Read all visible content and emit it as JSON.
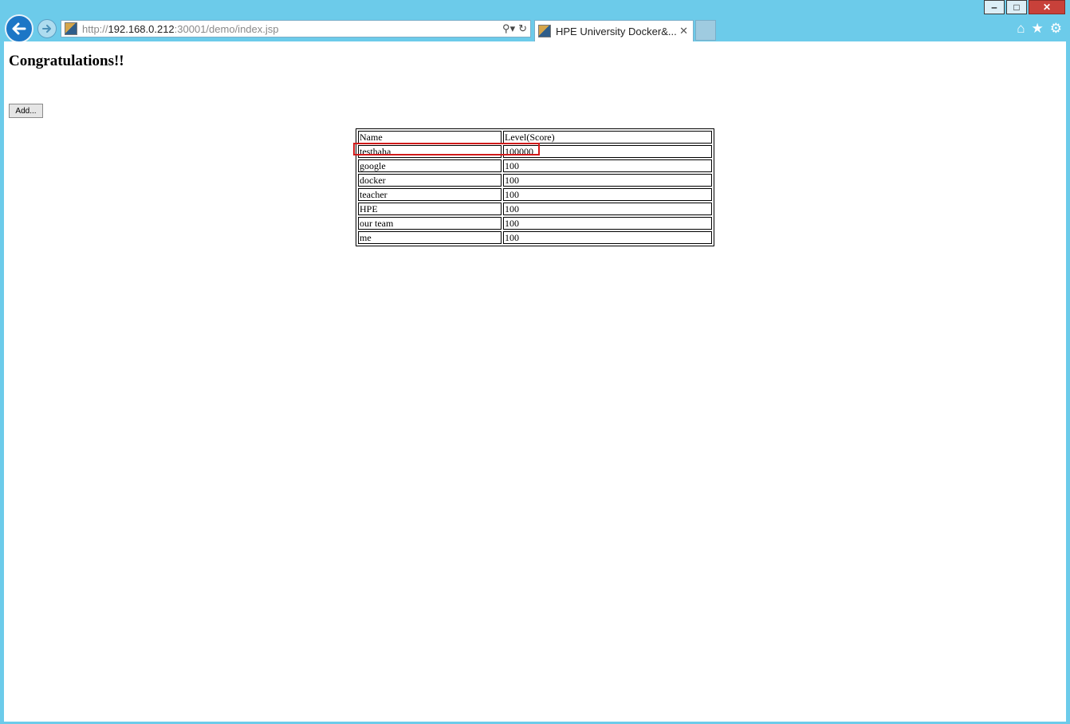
{
  "browser": {
    "url_prefix": "http://",
    "url_host": "192.168.0.212",
    "url_rest": ":30001/demo/index.jsp",
    "tab_title": "HPE University Docker&...",
    "window_buttons": {
      "minimize": "‒",
      "maximize": "□",
      "close": "✕"
    },
    "icons": {
      "back": "back-arrow-icon",
      "forward": "forward-arrow-icon",
      "search": "search-icon",
      "refresh": "refresh-icon",
      "home": "home-icon",
      "favorites": "star-icon",
      "tools": "gear-icon"
    }
  },
  "page": {
    "heading": "Congratulations!!",
    "add_button_label": "Add...",
    "table": {
      "headers": [
        "Name",
        "Level(Score)"
      ],
      "rows": [
        {
          "name": "testhaha",
          "score": "100000"
        },
        {
          "name": "google",
          "score": "100"
        },
        {
          "name": "docker",
          "score": "100"
        },
        {
          "name": "teacher",
          "score": "100"
        },
        {
          "name": "HPE",
          "score": "100"
        },
        {
          "name": "our team",
          "score": "100"
        },
        {
          "name": "me",
          "score": "100"
        }
      ]
    },
    "highlight_color": "#d11a1a"
  }
}
